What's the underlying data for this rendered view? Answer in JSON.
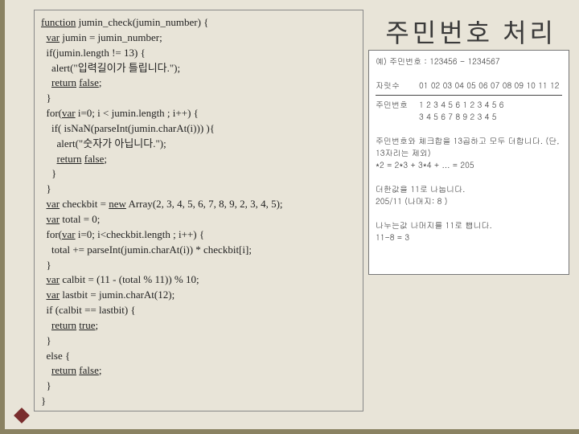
{
  "title": "주민번호 처리",
  "code": {
    "l1a": "function",
    "l1b": " jumin_check(jumin_number) {",
    "l2a": "  ",
    "l2b": "var",
    "l2c": " jumin = jumin_number;",
    "l3": "  if(jumin.length != 13) {",
    "l4": "    alert(\"입력길이가 틀립니다.\");",
    "l5a": "    ",
    "l5b": "return",
    "l5c": " ",
    "l5d": "false",
    "l5e": ";",
    "l6": "  }",
    "l7a": "  for(",
    "l7b": "var",
    "l7c": " i=0; i < jumin.length ; i++) {",
    "l8": "    if( isNaN(parseInt(jumin.charAt(i))) ){",
    "l9": "      alert(\"숫자가 아닙니다.\");",
    "l10a": "      ",
    "l10b": "return",
    "l10c": " ",
    "l10d": "false",
    "l10e": ";",
    "l11": "    }",
    "l12": "  }",
    "l13a": "  ",
    "l13b": "var",
    "l13c": " checkbit = ",
    "l13d": "new",
    "l13e": " Array(2, 3, 4, 5, 6, 7, 8, 9, 2, 3, 4, 5);",
    "l14a": "  ",
    "l14b": "var",
    "l14c": " total = 0;",
    "l15a": "  for(",
    "l15b": "var",
    "l15c": " i=0; i<checkbit.length ; i++) {",
    "l16": "    total += parseInt(jumin.charAt(i)) * checkbit[i];",
    "l17": "  }",
    "l18a": "  ",
    "l18b": "var",
    "l18c": " calbit = (11 - (total % 11)) % 10;",
    "l19a": "  ",
    "l19b": "var",
    "l19c": " lastbit = jumin.charAt(12);",
    "l20": "  if (calbit == lastbit) {",
    "l21a": "    ",
    "l21b": "return",
    "l21c": " ",
    "l21d": "true",
    "l21e": ";",
    "l22": "  }",
    "l23": "  else {",
    "l24a": "    ",
    "l24b": "return",
    "l24c": " ",
    "l24d": "false",
    "l24e": ";",
    "l25": "  }",
    "l26": "}"
  },
  "example": {
    "header": "예) 주민번호 : 123456 - 1234567",
    "row1_label": "자릿수",
    "row1_values": "01 02 03 04 05 06 07 08 09 10 11 12",
    "row2_label": "주민번호",
    "row2_values": "1  2  3  4  5  6  1  2  3  4  5  6",
    "row3_label": "",
    "row3_values": "3  4  5  6  7  8  9  2  3  4  5",
    "note1": "주민번호와 체크합을 13곱하고 모두 더합니다. (단, 13자리는 제외)",
    "formula1": "*2 = 2*3 + 3*4 + ... = 205",
    "note2": "더한값을 11로 나눕니다.",
    "formula2": "205/11 (나머지: 8 )",
    "note3": "나누는값 나머지를 11로 뺍니다.",
    "formula3": "11-8 = 3"
  }
}
